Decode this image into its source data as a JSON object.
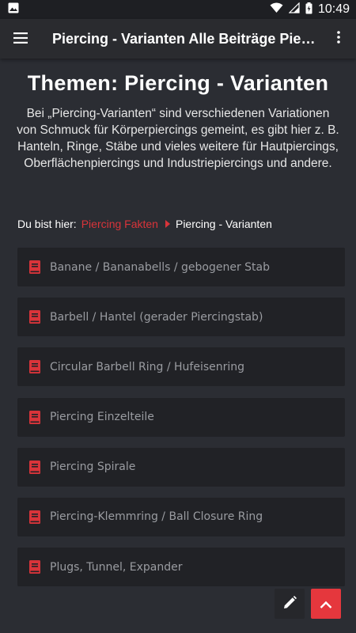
{
  "status_bar": {
    "time": "10:49"
  },
  "app_bar": {
    "title": "Piercing - Varianten Alle Beiträge Pie…"
  },
  "page": {
    "title": "Themen: Piercing - Varianten",
    "intro": "Bei „Piercing-Varianten“ sind verschiedenen Variationen von Schmuck für Körperpiercings gemeint, es gibt hier z. B. Hanteln, Ringe, Stäbe und vieles weitere für Hautpiercings, Oberflächenpiercings und Industriepiercings und andere."
  },
  "breadcrumb": {
    "prefix": "Du bist hier:",
    "link": "Piercing Fakten",
    "current": "Piercing - Varianten"
  },
  "items": [
    {
      "label": "Banane / Bananabells / gebogener Stab"
    },
    {
      "label": "Barbell / Hantel (gerader Piercingstab)"
    },
    {
      "label": "Circular Barbell Ring / Hufeisenring"
    },
    {
      "label": "Piercing Einzelteile"
    },
    {
      "label": "Piercing Spirale"
    },
    {
      "label": "Piercing-Klemmring / Ball Closure Ring"
    },
    {
      "label": "Plugs, Tunnel, Expander"
    }
  ],
  "colors": {
    "accent": "#d9343a",
    "background": "#2b2d33",
    "card": "#212226"
  },
  "icons": [
    "image-icon",
    "wifi-icon",
    "signal-icon",
    "battery-icon",
    "menu-icon",
    "more-vert-icon",
    "book-icon",
    "pencil-icon",
    "chevron-up-icon"
  ]
}
